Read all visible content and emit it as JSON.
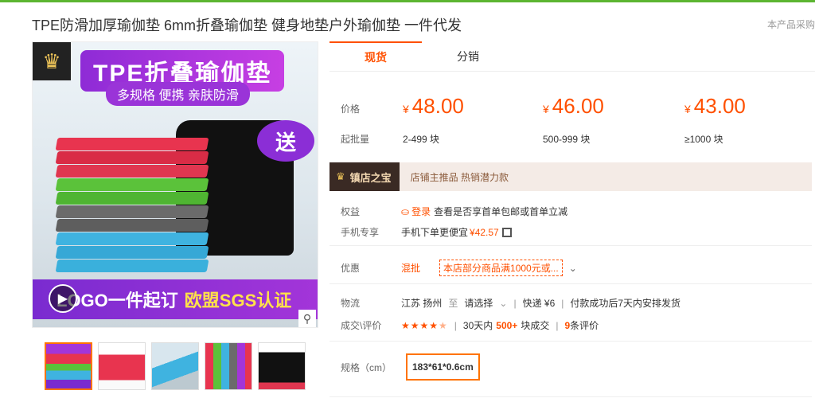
{
  "page_title": "TPE防滑加厚瑜伽垫 6mm折叠瑜伽垫 健身地垫户外瑜伽垫 一件代发",
  "corner_note": "本产品采购",
  "gallery": {
    "banner_title": "TPE折叠瑜伽垫",
    "banner_sub": "多规格 便携 亲肤防滑",
    "send_badge": "送",
    "bottom_text": "LOGO一件起订",
    "bottom_highlight": "欧盟SGS认证",
    "play_icon": "play-icon",
    "zoom_icon": "magnifier-icon",
    "thumbnails": 5
  },
  "tabs": [
    {
      "label": "现货",
      "active": true
    },
    {
      "label": "分销",
      "active": false
    }
  ],
  "pricing": {
    "price_label": "价格",
    "min_order_label": "起批量",
    "currency": "¥",
    "tiers": [
      {
        "price": "48.00",
        "qty": "2-499 块"
      },
      {
        "price": "46.00",
        "qty": "500-999 块"
      },
      {
        "price": "43.00",
        "qty": "≥1000 块"
      }
    ]
  },
  "shop": {
    "badge": "镇店之宝",
    "tags": "店铺主推品  热销潜力款"
  },
  "rights": {
    "label": "权益",
    "login": "登录",
    "text": "查看是否享首单包邮或首单立减"
  },
  "mobile": {
    "label": "手机专享",
    "text": "手机下单更便宜",
    "price": "¥42.57"
  },
  "promo": {
    "label": "优惠",
    "type": "混批",
    "coupon": "本店部分商品满1000元或..."
  },
  "logistics": {
    "label": "物流",
    "origin": "江苏 扬州",
    "to": "至",
    "select": "请选择",
    "express": "快递 ¥6",
    "ship_note": "付款成功后7天内安排发货"
  },
  "reviews": {
    "label": "成交\\评价",
    "rating": 4.5,
    "period": "30天内",
    "count": "500+",
    "unit": "块成交",
    "review_count": "9",
    "review_unit": "条评价"
  },
  "spec": {
    "label": "规格（cm）",
    "value": "183*61*0.6cm"
  },
  "colors": {
    "accent": "#ff5000",
    "topline": "#5cb531",
    "purple": "#9a34d8"
  }
}
